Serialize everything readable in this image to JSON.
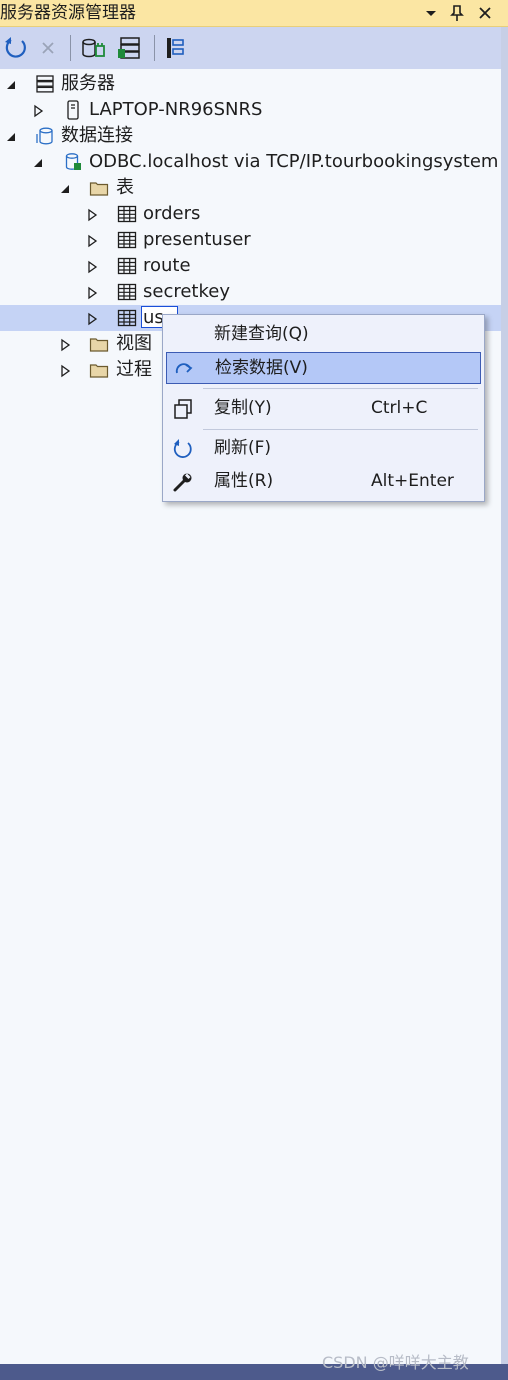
{
  "window": {
    "title": "服务器资源管理器",
    "buttons": [
      "dropdown-icon",
      "pin-icon",
      "close-icon"
    ]
  },
  "toolbar": {
    "buttons": [
      "refresh-icon",
      "stop-icon",
      "connect-to-database-icon",
      "connect-to-server-icon",
      "sharepoint-connection-icon"
    ]
  },
  "tree": {
    "servers": {
      "label": "服务器",
      "icon": "server-icon"
    },
    "server_node": {
      "label": "LAPTOP-NR96SNRS",
      "icon": "computer-icon"
    },
    "data_connections": {
      "label": "数据连接",
      "icon": "database-icon"
    },
    "connection": {
      "label": "ODBC.localhost via TCP/IP.tourbookingsystem",
      "icon": "database-connection-icon"
    },
    "tables_folder": {
      "label": "表",
      "icon": "folder-icon"
    },
    "tables": [
      "orders",
      "presentuser",
      "route",
      "secretkey"
    ],
    "editing_table": {
      "value": "us"
    },
    "views_folder": {
      "label": "视图",
      "icon": "folder-icon"
    },
    "procs_folder": {
      "label": "过程",
      "icon": "folder-icon"
    }
  },
  "context_menu": {
    "new_query": "新建查询(Q)",
    "retrieve_data": "检索数据(V)",
    "copy": "复制(Y)",
    "copy_shortcut": "Ctrl+C",
    "refresh": "刷新(F)",
    "properties": "属性(R)",
    "properties_shortcut": "Alt+Enter"
  },
  "watermark": "CSDN @咩咩大主教",
  "colors": {
    "title_bar": "#fbe6a3",
    "toolbar": "#ccd5f0",
    "selection": "#c5d3f5",
    "menu_highlight": "#b4c8f7",
    "accent": "#1a4fd8"
  }
}
